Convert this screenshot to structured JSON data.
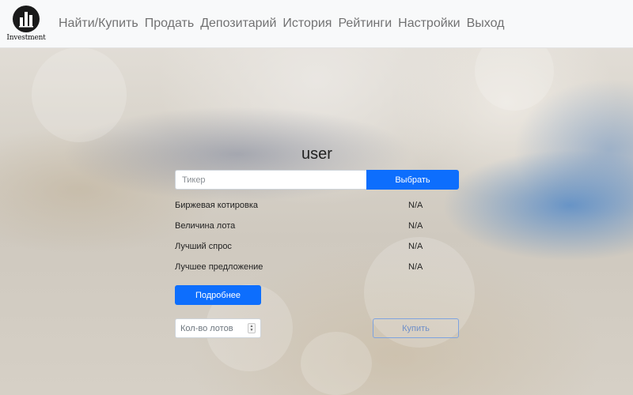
{
  "brand": {
    "text": "Investment",
    "logo_icon": "building-chart-icon"
  },
  "nav": {
    "items": [
      {
        "label": "Найти/Купить"
      },
      {
        "label": "Продать"
      },
      {
        "label": "Депозитарий"
      },
      {
        "label": "История"
      },
      {
        "label": "Рейтинги"
      },
      {
        "label": "Настройки"
      },
      {
        "label": "Выход"
      }
    ]
  },
  "main": {
    "username": "user",
    "ticker_placeholder": "Тикер",
    "ticker_value": "",
    "select_button": "Выбрать",
    "info": [
      {
        "label": "Биржевая котировка",
        "value": "N/A"
      },
      {
        "label": "Величина лота",
        "value": "N/A"
      },
      {
        "label": "Лучший спрос",
        "value": "N/A"
      },
      {
        "label": "Лучшее предложение",
        "value": "N/A"
      }
    ],
    "details_button": "Подробнее",
    "quantity_placeholder": "Кол-во лотов",
    "buy_button": "Купить"
  },
  "colors": {
    "primary": "#0d6efd",
    "navbar_bg": "#f8f9fa",
    "buy_outline": "#7ea3df"
  }
}
